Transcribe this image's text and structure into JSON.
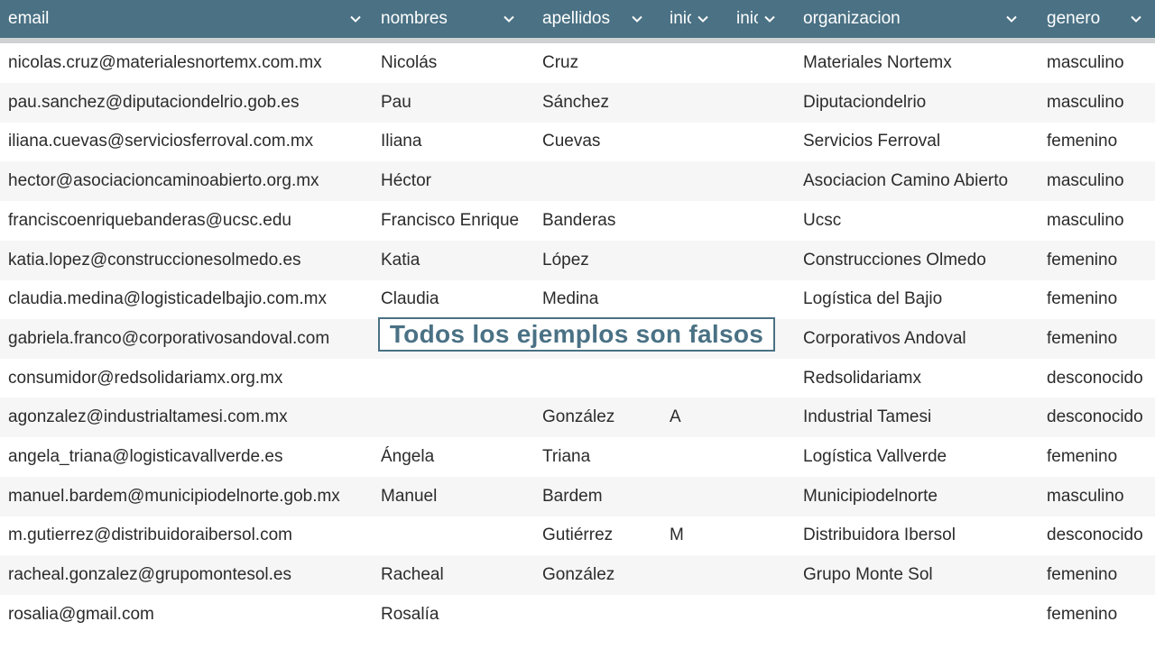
{
  "colors": {
    "header_bg": "#4a7184",
    "header_text": "#ffffff",
    "row_alt": "#f6f6f6",
    "watermark": "#4a7184"
  },
  "columns": [
    {
      "label": "email",
      "icon": "chevron-down-icon"
    },
    {
      "label": "nombres",
      "icon": "chevron-down-icon"
    },
    {
      "label": "apellidos",
      "icon": "chevron-down-icon"
    },
    {
      "label": "inic",
      "icon": "chevron-down-icon"
    },
    {
      "label": "inic",
      "icon": "chevron-down-icon"
    },
    {
      "label": "organizacion",
      "icon": "chevron-down-icon"
    },
    {
      "label": "genero",
      "icon": "chevron-down-icon"
    }
  ],
  "rows": [
    {
      "email": "nicolas.cruz@materialesnortemx.com.mx",
      "nombres": "Nicolás",
      "apellidos": "Cruz",
      "ini1": "",
      "ini2": "",
      "organizacion": "Materiales Nortemx",
      "genero": "masculino"
    },
    {
      "email": "pau.sanchez@diputaciondelrio.gob.es",
      "nombres": "Pau",
      "apellidos": "Sánchez",
      "ini1": "",
      "ini2": "",
      "organizacion": "Diputaciondelrio",
      "genero": "masculino"
    },
    {
      "email": "iliana.cuevas@serviciosferroval.com.mx",
      "nombres": "Iliana",
      "apellidos": "Cuevas",
      "ini1": "",
      "ini2": "",
      "organizacion": "Servicios Ferroval",
      "genero": "femenino"
    },
    {
      "email": "hector@asociacioncaminoabierto.org.mx",
      "nombres": "Héctor",
      "apellidos": "",
      "ini1": "",
      "ini2": "",
      "organizacion": "Asociacion Camino Abierto",
      "genero": "masculino"
    },
    {
      "email": "franciscoenriquebanderas@ucsc.edu",
      "nombres": "Francisco Enrique",
      "apellidos": "Banderas",
      "ini1": "",
      "ini2": "",
      "organizacion": "Ucsc",
      "genero": "masculino"
    },
    {
      "email": "katia.lopez@construccionesolmedo.es",
      "nombres": "Katia",
      "apellidos": "López",
      "ini1": "",
      "ini2": "",
      "organizacion": "Construcciones Olmedo",
      "genero": "femenino"
    },
    {
      "email": "claudia.medina@logisticadelbajio.com.mx",
      "nombres": "Claudia",
      "apellidos": "Medina",
      "ini1": "",
      "ini2": "",
      "organizacion": "Logística del Bajio",
      "genero": "femenino"
    },
    {
      "email": "gabriela.franco@corporativosandoval.com",
      "nombres": "",
      "apellidos": "",
      "ini1": "",
      "ini2": "",
      "organizacion": "Corporativos Andoval",
      "genero": "femenino"
    },
    {
      "email": "consumidor@redsolidariamx.org.mx",
      "nombres": "",
      "apellidos": "",
      "ini1": "",
      "ini2": "",
      "organizacion": "Redsolidariamx",
      "genero": "desconocido"
    },
    {
      "email": "agonzalez@industrialtamesi.com.mx",
      "nombres": "",
      "apellidos": "González",
      "ini1": "A",
      "ini2": "",
      "organizacion": "Industrial Tamesi",
      "genero": "desconocido"
    },
    {
      "email": "angela_triana@logisticavallverde.es",
      "nombres": "Ángela",
      "apellidos": "Triana",
      "ini1": "",
      "ini2": "",
      "organizacion": "Logística Vallverde",
      "genero": "femenino"
    },
    {
      "email": "manuel.bardem@municipiodelnorte.gob.mx",
      "nombres": "Manuel",
      "apellidos": "Bardem",
      "ini1": "",
      "ini2": "",
      "organizacion": "Municipiodelnorte",
      "genero": "masculino"
    },
    {
      "email": "m.gutierrez@distribuidoraibersol.com",
      "nombres": "",
      "apellidos": "Gutiérrez",
      "ini1": "M",
      "ini2": "",
      "organizacion": "Distribuidora Ibersol",
      "genero": "desconocido"
    },
    {
      "email": "racheal.gonzalez@grupomontesol.es",
      "nombres": "Racheal",
      "apellidos": "González",
      "ini1": "",
      "ini2": "",
      "organizacion": "Grupo Monte Sol",
      "genero": "femenino"
    },
    {
      "email": "rosalia@gmail.com",
      "nombres": "Rosalía",
      "apellidos": "",
      "ini1": "",
      "ini2": "",
      "organizacion": "",
      "genero": "femenino"
    }
  ],
  "watermark": "Todos los ejemplos son falsos"
}
